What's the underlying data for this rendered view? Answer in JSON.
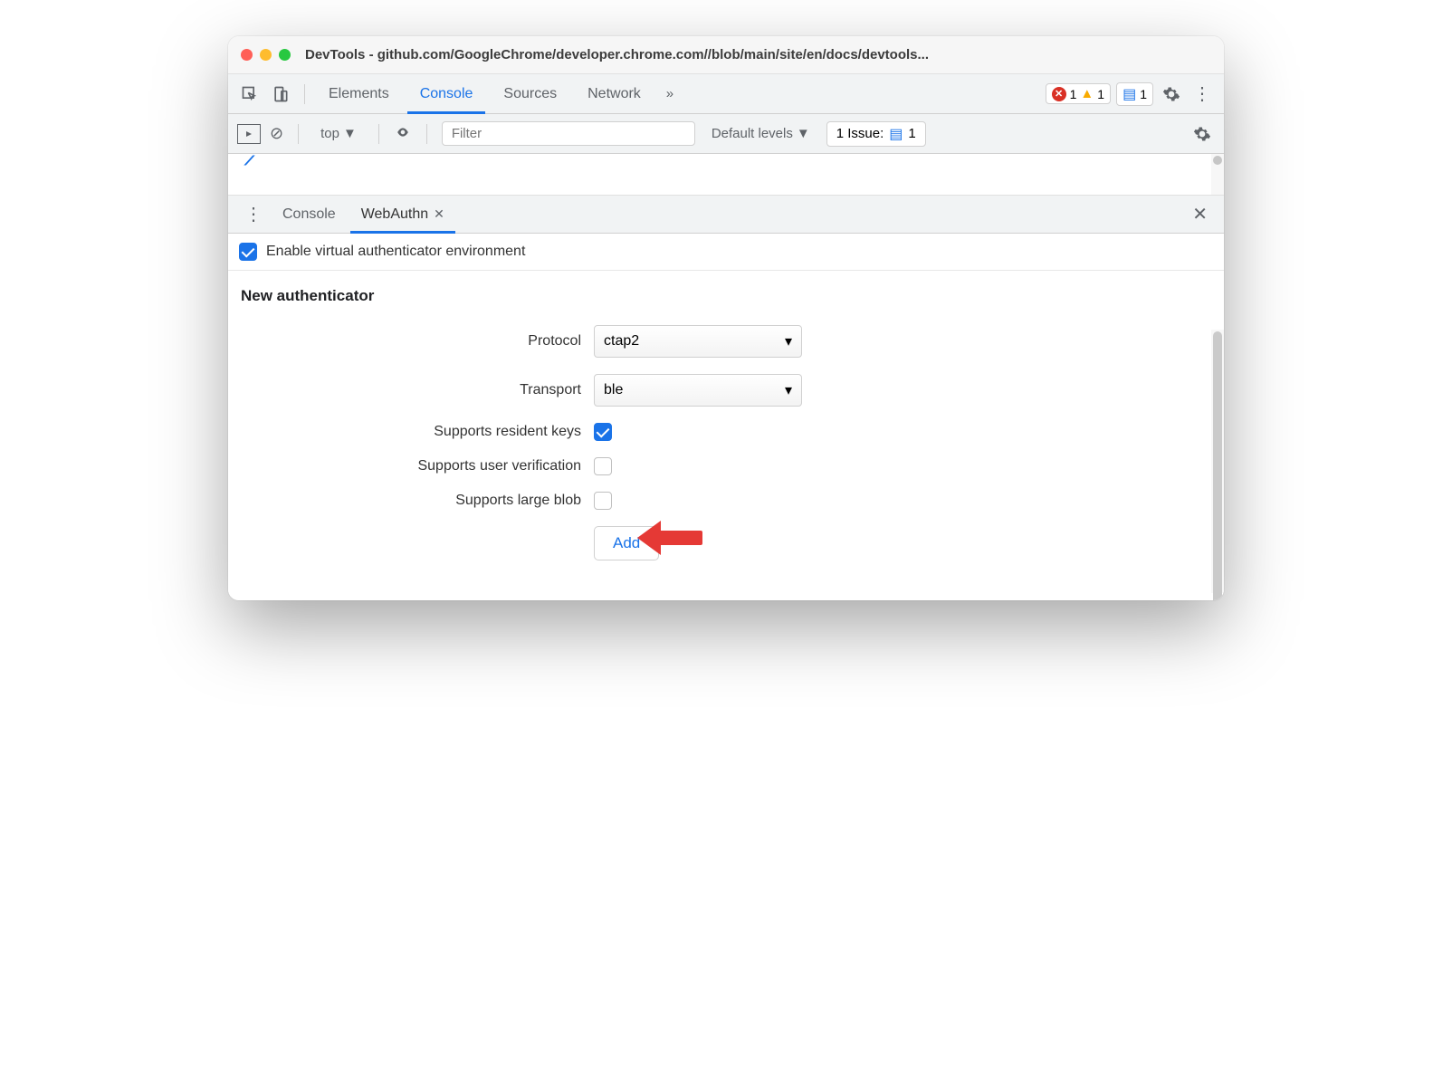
{
  "window": {
    "title": "DevTools - github.com/GoogleChrome/developer.chrome.com//blob/main/site/en/docs/devtools..."
  },
  "tabs": {
    "elements": "Elements",
    "console": "Console",
    "sources": "Sources",
    "network": "Network"
  },
  "badges": {
    "errors": "1",
    "warnings": "1",
    "messages": "1"
  },
  "consolebar": {
    "context": "top",
    "filter_placeholder": "Filter",
    "levels": "Default levels",
    "issues_label": "1 Issue:",
    "issues_count": "1"
  },
  "drawer": {
    "tabs": {
      "console": "Console",
      "webauthn": "WebAuthn"
    }
  },
  "webauthn": {
    "enable_label": "Enable virtual authenticator environment",
    "enable_checked": true,
    "heading": "New authenticator",
    "protocol_label": "Protocol",
    "protocol_value": "ctap2",
    "transport_label": "Transport",
    "transport_value": "ble",
    "resident_keys_label": "Supports resident keys",
    "resident_keys_checked": true,
    "user_verification_label": "Supports user verification",
    "user_verification_checked": false,
    "large_blob_label": "Supports large blob",
    "large_blob_checked": false,
    "add_label": "Add"
  }
}
